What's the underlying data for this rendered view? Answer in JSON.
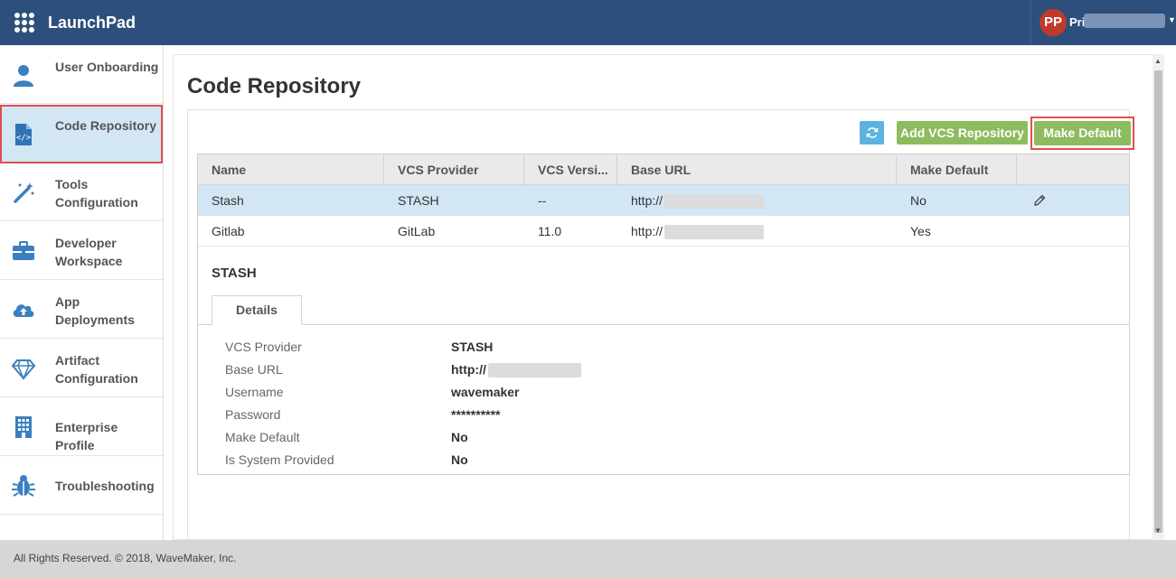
{
  "header": {
    "app_title": "LaunchPad",
    "user_initials": "PP",
    "user_name_prefix": "Pri",
    "brand_color": "#2d4f7c"
  },
  "sidebar": {
    "items": [
      {
        "label": "User Onboarding",
        "icon": "user-icon"
      },
      {
        "label": "Code Repository",
        "icon": "code-file-icon",
        "active": true
      },
      {
        "label": "Tools Configuration",
        "icon": "magic-wand-icon"
      },
      {
        "label": "Developer Workspace",
        "icon": "briefcase-icon"
      },
      {
        "label": "App Deployments",
        "icon": "cloud-upload-icon"
      },
      {
        "label": "Artifact Configuration",
        "icon": "diamond-icon"
      },
      {
        "label": "Enterprise Profile",
        "icon": "building-icon"
      },
      {
        "label": "Troubleshooting",
        "icon": "bug-icon"
      }
    ]
  },
  "main": {
    "page_title": "Code Repository",
    "toolbar": {
      "refresh_icon": "refresh-icon",
      "add_label": "Add VCS Repository",
      "make_default_label": "Make Default"
    },
    "table": {
      "columns": [
        "Name",
        "VCS Provider",
        "VCS Versi...",
        "Base URL",
        "Make Default"
      ],
      "rows": [
        {
          "name": "Stash",
          "provider": "STASH",
          "version": "--",
          "url_prefix": "http://",
          "make_default": "No",
          "selected": true
        },
        {
          "name": "Gitlab",
          "provider": "GitLab",
          "version": "11.0",
          "url_prefix": "http://",
          "make_default": "Yes",
          "selected": false
        }
      ]
    },
    "detail": {
      "title": "STASH",
      "tab_label": "Details",
      "fields": [
        {
          "label": "VCS Provider",
          "value": "STASH"
        },
        {
          "label": "Base URL",
          "value": "http://"
        },
        {
          "label": "Username",
          "value": "wavemaker"
        },
        {
          "label": "Password",
          "value": "**********"
        },
        {
          "label": "Make Default",
          "value": "No"
        },
        {
          "label": "Is System Provided",
          "value": "No"
        }
      ]
    }
  },
  "footer": {
    "text": "All Rights Reserved. © 2018, WaveMaker, Inc."
  }
}
